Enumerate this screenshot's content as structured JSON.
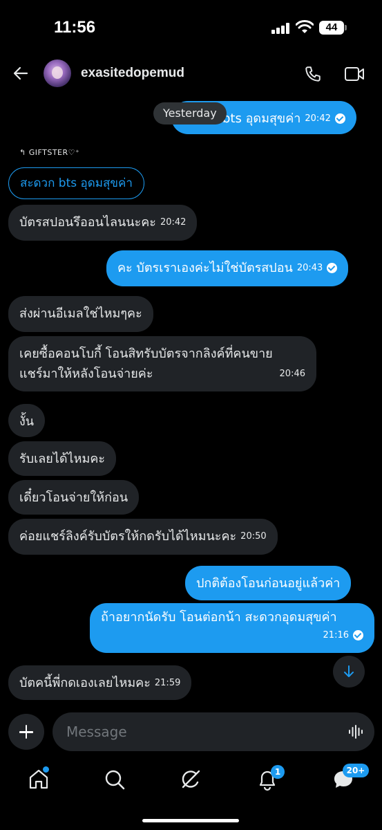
{
  "status_bar": {
    "time": "11:56",
    "battery": "44"
  },
  "header": {
    "username": "exasitedopemud"
  },
  "chat": {
    "date_separator": "Yesterday",
    "first_out": {
      "text": "bts อุดมสุขค่า",
      "time": "20:42"
    },
    "reply_label": "GIFTSTER♡⁺",
    "quoted_text": "สะดวก bts อุดมสุขค่า",
    "messages": [
      {
        "direction": "in",
        "text": "บัตรสปอนรึออนไลนนะคะ",
        "time": "20:42"
      },
      {
        "direction": "out",
        "text": "คะ บัตรเราเองค่ะไม่ใช่บัตรสปอน",
        "time": "20:43"
      },
      {
        "direction": "in",
        "text": "ส่งผ่านอีเมลใช่ไหมๆคะ",
        "time": ""
      },
      {
        "direction": "in",
        "line1": "เคยซื้อคอนโบกี้ โอนสิทรับบัตรจากลิงค์ที่คนขาย",
        "line2": "แชร์มาให้หลังโอนจ่ายค่ะ",
        "time": "20:46"
      },
      {
        "direction": "in",
        "text": "งั้น",
        "time": ""
      },
      {
        "direction": "in",
        "text": "รับเลยได้ไหมคะ",
        "time": ""
      },
      {
        "direction": "in",
        "text": "เดี๋ยวโอนจ่ายให้ก่อน",
        "time": ""
      },
      {
        "direction": "in",
        "text": "ค่อยแชร์ลิงค์รับบัตรให้กดรับได้ไหมนะคะ",
        "time": "20:50"
      },
      {
        "direction": "out",
        "text": "ปกติต้องโอนก่อนอยู่แล้วค่า",
        "time": ""
      },
      {
        "direction": "out",
        "text": "ถ้าอยากนัดรับ โอนต่อกน้า สะดวกอุดมสุขค่า",
        "time": "21:16"
      },
      {
        "direction": "in",
        "text": "บัตคนี้พี่กดเองเลยไหมคะ",
        "time": "21:59"
      }
    ]
  },
  "composer": {
    "placeholder": "Message"
  },
  "nav": {
    "notifications_badge": "1",
    "messages_badge": "20+"
  },
  "colors": {
    "accent": "#1d9bf0",
    "bubble_in": "#202327",
    "background": "#000000"
  },
  "icons": [
    "back-arrow-icon",
    "phone-icon",
    "video-icon",
    "plus-icon",
    "voice-icon",
    "home-icon",
    "search-icon",
    "grok-icon",
    "bell-icon",
    "messages-icon",
    "arrow-down-icon"
  ]
}
